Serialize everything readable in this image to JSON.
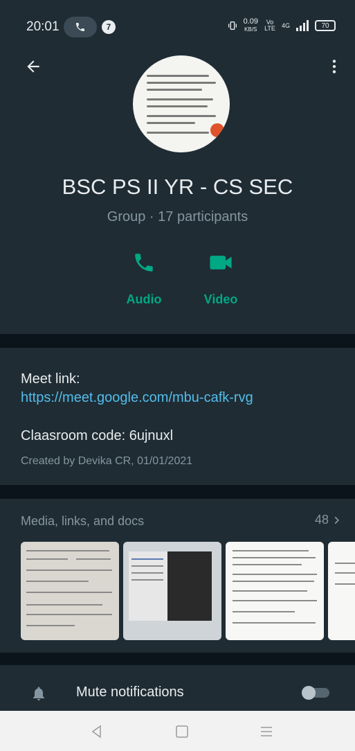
{
  "status_bar": {
    "time": "20:01",
    "notification_count": "7",
    "net_speed_value": "0.09",
    "net_speed_unit": "KB/S",
    "volte": "Vo LTE",
    "network": "4G",
    "battery": "70"
  },
  "group": {
    "title": "BSC PS II YR -  CS SEC",
    "subtitle": "Group · 17 participants"
  },
  "actions": [
    {
      "label": "Audio",
      "icon": "phone-icon"
    },
    {
      "label": "Video",
      "icon": "video-camera-icon"
    }
  ],
  "description": {
    "meet_label": "Meet link:",
    "meet_url": "https://meet.google.com/mbu-cafk-rvg",
    "classroom_code": "Claasroom code: 6ujnuxl",
    "created": "Created by Devika CR, 01/01/2021"
  },
  "media": {
    "title": "Media, links, and docs",
    "count": "48"
  },
  "mute": {
    "label": "Mute notifications",
    "enabled": false
  },
  "colors": {
    "background": "#0b141a",
    "panel": "#1f2c34",
    "accent": "#00a884",
    "link": "#53bdeb",
    "secondary_text": "#8696a0"
  }
}
